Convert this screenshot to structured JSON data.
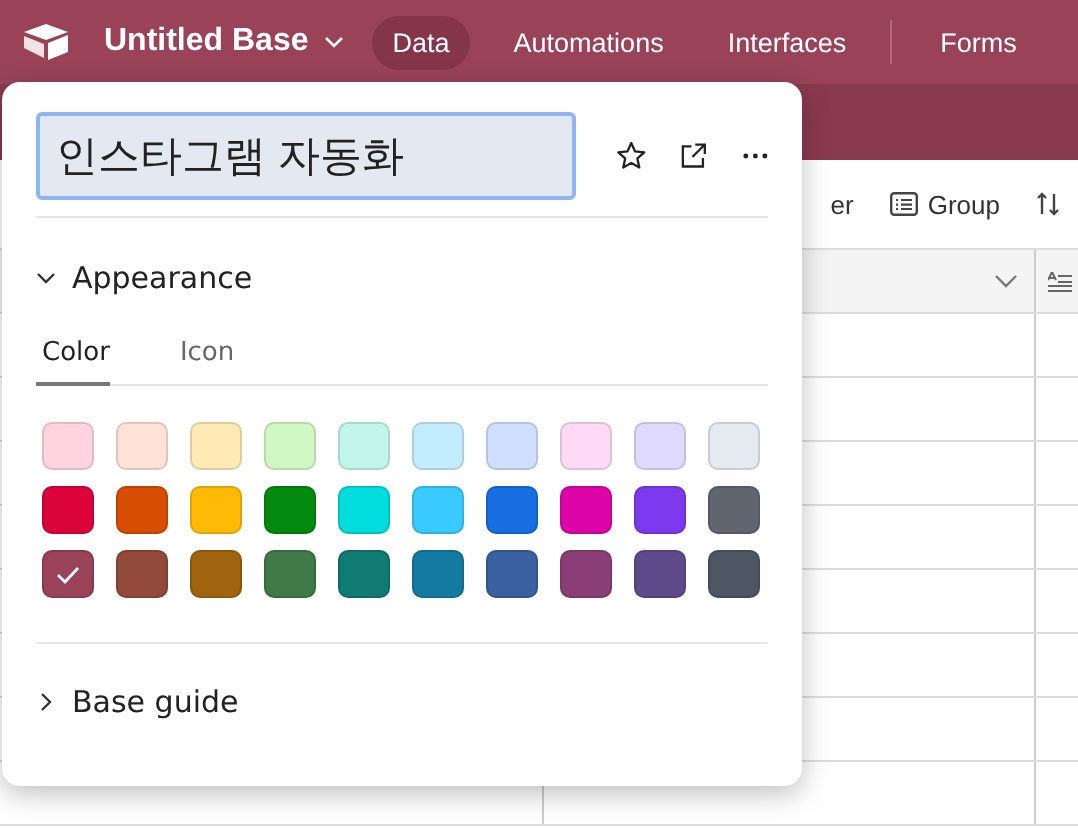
{
  "header": {
    "base_name": "Untitled Base",
    "nav": [
      {
        "label": "Data",
        "selected": true
      },
      {
        "label": "Automations",
        "selected": false
      },
      {
        "label": "Interfaces",
        "selected": false
      },
      {
        "label": "Forms",
        "selected": false
      }
    ]
  },
  "toolbar": [
    {
      "kind": "filter",
      "label": "er"
    },
    {
      "kind": "group",
      "label": "Group"
    },
    {
      "kind": "sort"
    }
  ],
  "popover": {
    "name_field": {
      "value": "인스타그램 자동화"
    },
    "appearance": {
      "title": "Appearance",
      "expanded": true,
      "tabs": [
        {
          "label": "Color",
          "selected": true
        },
        {
          "label": "Icon",
          "selected": false
        }
      ],
      "swatches": [
        {
          "color": "#ffd4e0",
          "selected": false
        },
        {
          "color": "#fee2d5",
          "selected": false
        },
        {
          "color": "#ffeab6",
          "selected": false
        },
        {
          "color": "#d1f7c4",
          "selected": false
        },
        {
          "color": "#c2f5e9",
          "selected": false
        },
        {
          "color": "#c4ecff",
          "selected": false
        },
        {
          "color": "#cfdfff",
          "selected": false
        },
        {
          "color": "#ffdaf6",
          "selected": false
        },
        {
          "color": "#e0daff",
          "selected": false
        },
        {
          "color": "#e5e9f0",
          "selected": false
        },
        {
          "color": "#dc043b",
          "selected": false
        },
        {
          "color": "#d74d02",
          "selected": false
        },
        {
          "color": "#ffba05",
          "selected": false
        },
        {
          "color": "#048a0e",
          "selected": false
        },
        {
          "color": "#01dddd",
          "selected": false
        },
        {
          "color": "#39caff",
          "selected": false
        },
        {
          "color": "#166ee1",
          "selected": false
        },
        {
          "color": "#dd04a8",
          "selected": false
        },
        {
          "color": "#7c39ed",
          "selected": false
        },
        {
          "color": "#616570",
          "selected": false
        },
        {
          "color": "#9a4358",
          "selected": true
        },
        {
          "color": "#924b3a",
          "selected": false
        },
        {
          "color": "#a0640f",
          "selected": false
        },
        {
          "color": "#3f7a48",
          "selected": false
        },
        {
          "color": "#0f7b72",
          "selected": false
        },
        {
          "color": "#137ba0",
          "selected": false
        },
        {
          "color": "#3a609f",
          "selected": false
        },
        {
          "color": "#8a3e75",
          "selected": false
        },
        {
          "color": "#614a8a",
          "selected": false
        },
        {
          "color": "#4f5663",
          "selected": false
        }
      ]
    },
    "guide": {
      "title": "Base guide",
      "expanded": false
    }
  }
}
